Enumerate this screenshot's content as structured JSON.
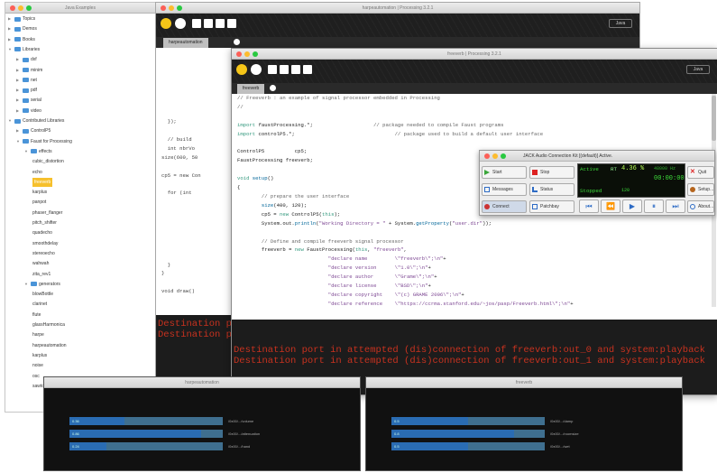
{
  "examples": {
    "title": "Java Examples",
    "items": [
      {
        "label": "Topics",
        "level": 0,
        "open": false,
        "folder": true
      },
      {
        "label": "Demos",
        "level": 0,
        "open": false,
        "folder": true
      },
      {
        "label": "Books",
        "level": 0,
        "open": false,
        "folder": true
      },
      {
        "label": "Libraries",
        "level": 0,
        "open": true,
        "folder": true
      },
      {
        "label": "dxf",
        "level": 1,
        "open": false,
        "folder": true
      },
      {
        "label": "minim",
        "level": 1,
        "open": false,
        "folder": true
      },
      {
        "label": "net",
        "level": 1,
        "open": false,
        "folder": true
      },
      {
        "label": "pdf",
        "level": 1,
        "open": false,
        "folder": true
      },
      {
        "label": "serial",
        "level": 1,
        "open": false,
        "folder": true
      },
      {
        "label": "video",
        "level": 1,
        "open": false,
        "folder": true
      },
      {
        "label": "Contributed Libraries",
        "level": 0,
        "open": true,
        "folder": true
      },
      {
        "label": "ControlP5",
        "level": 1,
        "open": false,
        "folder": true
      },
      {
        "label": "Faust for Processing",
        "level": 1,
        "open": true,
        "folder": true
      },
      {
        "label": "effects",
        "level": 2,
        "open": true,
        "folder": true
      },
      {
        "label": "cubic_distortion",
        "level": 3
      },
      {
        "label": "echo",
        "level": 3
      },
      {
        "label": "freeverb",
        "level": 3,
        "selected": true
      },
      {
        "label": "karplus",
        "level": 3
      },
      {
        "label": "panpot",
        "level": 3
      },
      {
        "label": "phaser_flanger",
        "level": 3
      },
      {
        "label": "pitch_shifter",
        "level": 3
      },
      {
        "label": "quadecho",
        "level": 3
      },
      {
        "label": "smoothdelay",
        "level": 3
      },
      {
        "label": "stereoecho",
        "level": 3
      },
      {
        "label": "wahwah",
        "level": 3
      },
      {
        "label": "zita_rev1",
        "level": 3
      },
      {
        "label": "generators",
        "level": 2,
        "open": true,
        "folder": true
      },
      {
        "label": "blowBottle",
        "level": 3
      },
      {
        "label": "clarinet",
        "level": 3
      },
      {
        "label": "flute",
        "level": 3
      },
      {
        "label": "glassHarmonica",
        "level": 3
      },
      {
        "label": "harpe",
        "level": 3
      },
      {
        "label": "harpeautomation",
        "level": 3
      },
      {
        "label": "karplus",
        "level": 3
      },
      {
        "label": "noise",
        "level": 3
      },
      {
        "label": "osc",
        "level": 3
      },
      {
        "label": "sawtooth",
        "level": 3
      }
    ]
  },
  "harpe": {
    "title": "harpeautomation | Processing 3.2.1",
    "tab": "harpeautomation",
    "mode": "Java",
    "code": [
      "",
      "",
      "",
      "",
      "",
      "",
      "",
      "",
      "",
      "",
      "  });",
      "",
      "  // build",
      "  int nbrVo",
      "size(600, 50",
      "",
      "cp5 = new Con",
      "",
      "  for (int",
      "",
      "",
      "",
      "",
      "",
      "",
      "",
      "  }",
      "}",
      "",
      "void draw()"
    ],
    "console": [
      "Destination p",
      "Destination p"
    ]
  },
  "freeverb": {
    "title": "freeverb | Processing 3.2.1",
    "tab": "freeverb",
    "mode": "Java",
    "code": [
      [
        [
          "// Freeverb : an example of signal processor embedded in Processing",
          "cm"
        ]
      ],
      [
        [
          "//",
          "cm"
        ]
      ],
      [],
      [
        [
          "import",
          "kw"
        ],
        [
          " faustProcessing.*;                    ",
          ""
        ],
        [
          "// package needed to compile Faust programs",
          "cm"
        ]
      ],
      [
        [
          "import",
          "kw"
        ],
        [
          " controlP5.*;                                 ",
          ""
        ],
        [
          "// package used to build a default user interface",
          "cm"
        ]
      ],
      [],
      [
        [
          "ControlP5          cp5;",
          ""
        ]
      ],
      [
        [
          "FaustProcessing freeverb;",
          ""
        ]
      ],
      [],
      [
        [
          "void",
          "kw"
        ],
        [
          " ",
          ""
        ],
        [
          "setup",
          "fn"
        ],
        [
          "()",
          ""
        ]
      ],
      [
        [
          "{",
          ""
        ]
      ],
      [
        [
          "        ",
          ""
        ],
        [
          "// prepare the user interface",
          "cm"
        ]
      ],
      [
        [
          "        ",
          ""
        ],
        [
          "size",
          "fn"
        ],
        [
          "(400, 120);",
          ""
        ]
      ],
      [
        [
          "        cp5 = ",
          ""
        ],
        [
          "new",
          "kw"
        ],
        [
          " ControlP5(",
          ""
        ],
        [
          "this",
          "kw"
        ],
        [
          ");",
          ""
        ]
      ],
      [
        [
          "        System.out.",
          ""
        ],
        [
          "println",
          "fn"
        ],
        [
          "(",
          ""
        ],
        [
          "\"Working Directory = \"",
          "str"
        ],
        [
          " + System.",
          ""
        ],
        [
          "getProperty",
          "fn"
        ],
        [
          "(",
          ""
        ],
        [
          "\"user.dir\"",
          "str"
        ],
        [
          "));",
          ""
        ]
      ],
      [],
      [
        [
          "        ",
          ""
        ],
        [
          "// Define and compile freeverb signal processor",
          "cm"
        ]
      ],
      [
        [
          "        freeverb = ",
          ""
        ],
        [
          "new",
          "kw"
        ],
        [
          " FaustProcessing(",
          ""
        ],
        [
          "this",
          "kw"
        ],
        [
          ", ",
          ""
        ],
        [
          "\"freeverb\"",
          "str"
        ],
        [
          ",",
          ""
        ]
      ],
      [
        [
          "                              ",
          ""
        ],
        [
          "\"declare name         \\\"freeverb\\\";\\n\"",
          "str"
        ],
        [
          "+",
          ""
        ]
      ],
      [
        [
          "                              ",
          ""
        ],
        [
          "\"declare version      \\\"1.0\\\";\\n\"",
          "str"
        ],
        [
          "+",
          ""
        ]
      ],
      [
        [
          "                              ",
          ""
        ],
        [
          "\"declare author       \\\"Grame\\\";\\n\"",
          "str"
        ],
        [
          "+",
          ""
        ]
      ],
      [
        [
          "                              ",
          ""
        ],
        [
          "\"declare license      \\\"BSD\\\";\\n\"",
          "str"
        ],
        [
          "+",
          ""
        ]
      ],
      [
        [
          "                              ",
          ""
        ],
        [
          "\"declare copyright    \\\"(c) GRAME 2006\\\";\\n\"",
          "str"
        ],
        [
          "+",
          ""
        ]
      ],
      [
        [
          "                              ",
          ""
        ],
        [
          "\"declare reference    \\\"https://ccrma.stanford.edu/~jos/pasp/Freeverb.html\\\";\\n\"",
          "str"
        ],
        [
          "+",
          ""
        ]
      ]
    ],
    "console": [
      "Destination port in attempted (dis)connection of freeverb:out_0 and system:playback",
      "Destination port in attempted (dis)connection of freeverb:out_1 and system:playback"
    ]
  },
  "jack": {
    "title": "JACK Audio Connection Kit [(default)] Active.",
    "buttons": {
      "start": "Start",
      "stop": "Stop",
      "quit": "Quit",
      "messages": "Messages",
      "status": "Status",
      "setup": "Setup...",
      "connect": "Connect",
      "patchbay": "Patchbay",
      "about": "About..."
    },
    "display": {
      "state": "Active",
      "rt": "RT",
      "dsp": "4.36 %",
      "rate": "48000 Hz",
      "time": "00:00:00",
      "transport": "Stopped",
      "bpm": "120"
    }
  },
  "harpe_ui": {
    "title": "harpeautomation",
    "sliders": [
      {
        "label": "0.36",
        "value": 0.36,
        "readout": "/0x00/.../volume"
      },
      {
        "label": "0.86",
        "value": 0.86,
        "readout": "/0x00/.../attenuation"
      },
      {
        "label": "0.24",
        "value": 0.24,
        "readout": "/0x00/.../hand"
      }
    ]
  },
  "freeverb_ui": {
    "title": "freeverb",
    "sliders": [
      {
        "label": "0.5",
        "value": 0.5,
        "readout": "/0x00/.../damp"
      },
      {
        "label": "0.8",
        "value": 0.8,
        "readout": "/0x00/.../roomsize"
      },
      {
        "label": "0.5",
        "value": 0.5,
        "readout": "/0x00/.../wet"
      }
    ]
  }
}
